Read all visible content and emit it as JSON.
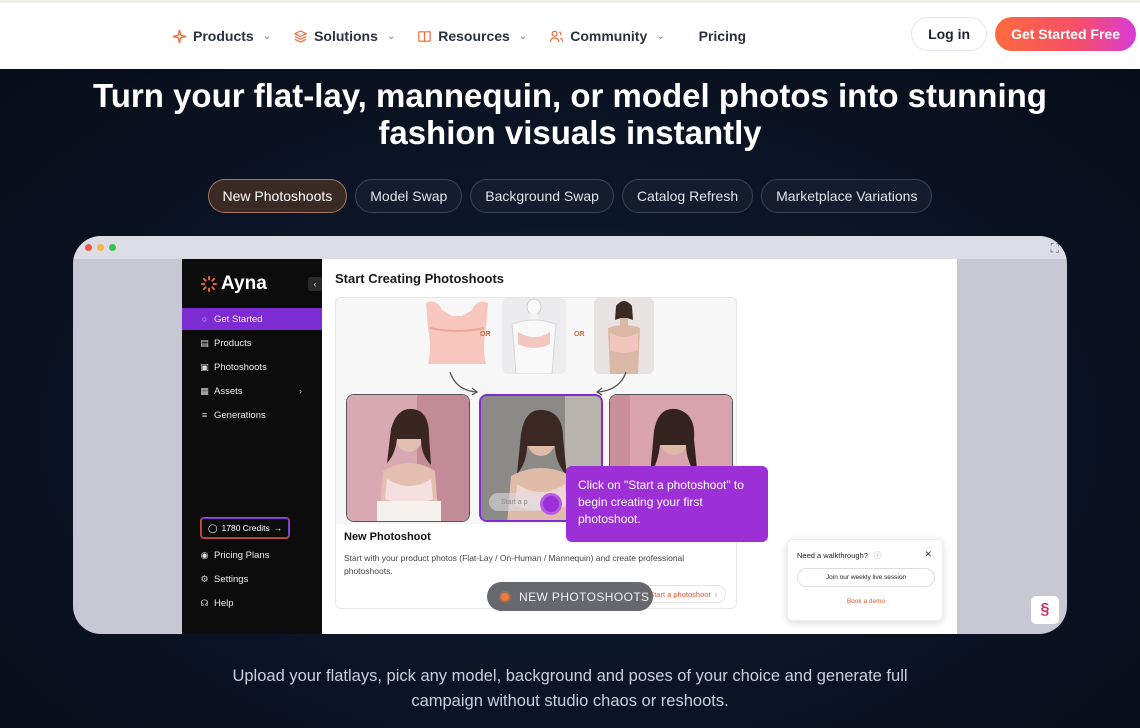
{
  "nav": {
    "items": [
      {
        "label": "Products",
        "icon": "sparkle-icon",
        "dropdown": true
      },
      {
        "label": "Solutions",
        "icon": "layers-icon",
        "dropdown": true
      },
      {
        "label": "Resources",
        "icon": "book-icon",
        "dropdown": true
      },
      {
        "label": "Community",
        "icon": "users-icon",
        "dropdown": true
      },
      {
        "label": "Pricing",
        "dropdown": false
      }
    ],
    "login": "Log in",
    "cta": "Get Started Free"
  },
  "hero": {
    "headline_line1": "Turn your flat-lay, mannequin, or model photos into stunning",
    "headline_line2": "fashion visuals instantly",
    "tabs": [
      "New Photoshoots",
      "Model Swap",
      "Background Swap",
      "Catalog Refresh",
      "Marketplace Variations"
    ],
    "active_tab": "New Photoshoots",
    "subtext_line1": "Upload your flatlays, pick any model, background and poses of your choice and generate full",
    "subtext_line2": "campaign without studio chaos or reshoots."
  },
  "app": {
    "brand": "Ayna",
    "sidebar": {
      "items": [
        "Get Started",
        "Products",
        "Photoshoots",
        "Assets",
        "Generations"
      ],
      "credits": "1780 Credits",
      "bottom": [
        "Pricing Plans",
        "Settings",
        "Help"
      ]
    },
    "title": "Start Creating Photoshoots",
    "or_label": "OR",
    "card": {
      "title": "New Photoshoot",
      "desc": "Start with your product photos (Flat-Lay / On-Human / Mannequin) and create professional photoshoots.",
      "link": "Start a photoshoot",
      "ghost_button": "Start a p"
    },
    "tooltip": "Click on \"Start a photoshoot\" to begin creating your first photoshoot.",
    "walkthrough": {
      "title": "Need a walkthrough?",
      "button": "Join our weekly live session",
      "demo": "Book a demo"
    },
    "overlay_pill": "NEW PHOTOSHOOTS"
  },
  "colors": {
    "accent_purple": "#7d2bd3",
    "cta_orange": "#ff6a3d",
    "hero_bg": "#0b1220"
  }
}
